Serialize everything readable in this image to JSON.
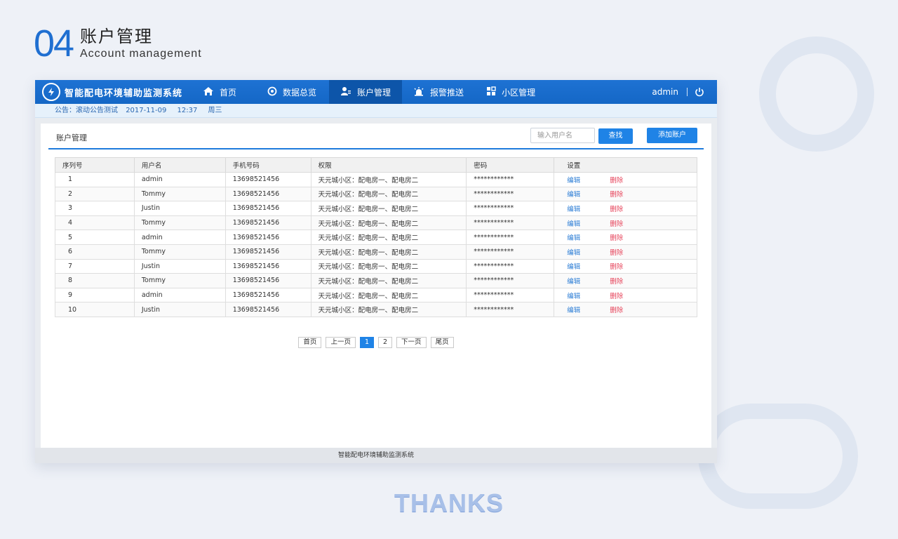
{
  "slide": {
    "number": "04",
    "title": "账户管理",
    "subtitle": "Account management",
    "thanks": "THANKS"
  },
  "app": {
    "brand": "智能配电环境辅助监测系统",
    "nav": [
      {
        "label": "首页",
        "icon": "home-icon"
      },
      {
        "label": "数据总览",
        "icon": "dashboard-icon"
      },
      {
        "label": "账户管理",
        "icon": "user-manage-icon",
        "active": true
      },
      {
        "label": "报警推送",
        "icon": "alarm-icon"
      },
      {
        "label": "小区管理",
        "icon": "grid-icon"
      }
    ],
    "user": "admin",
    "notice": {
      "label": "公告：滚动公告测试",
      "date": "2017-11-09",
      "time": "12:37",
      "weekday": "周三"
    },
    "footer": "智能配电环境辅助监测系统",
    "accent": "#1f83e6",
    "danger": "#e6435a"
  },
  "panel": {
    "title": "账户管理",
    "search_placeholder": "输入用户名",
    "search_button": "查找",
    "add_button": "添加账户"
  },
  "table": {
    "headers": [
      "序列号",
      "用户名",
      "手机号码",
      "权限",
      "密码",
      "设置"
    ],
    "edit_label": "编辑",
    "delete_label": "删除",
    "rows": [
      {
        "idx": "1",
        "user": "admin",
        "phone": "13698521456",
        "perm": "天元城小区：配电房一、配电房二",
        "pwd": "************"
      },
      {
        "idx": "2",
        "user": "Tommy",
        "phone": "13698521456",
        "perm": "天元城小区：配电房一、配电房二",
        "pwd": "************"
      },
      {
        "idx": "3",
        "user": "Justin",
        "phone": "13698521456",
        "perm": "天元城小区：配电房一、配电房二",
        "pwd": "************"
      },
      {
        "idx": "4",
        "user": "Tommy",
        "phone": "13698521456",
        "perm": "天元城小区：配电房一、配电房二",
        "pwd": "************"
      },
      {
        "idx": "5",
        "user": "admin",
        "phone": "13698521456",
        "perm": "天元城小区：配电房一、配电房二",
        "pwd": "************"
      },
      {
        "idx": "6",
        "user": "Tommy",
        "phone": "13698521456",
        "perm": "天元城小区：配电房一、配电房二",
        "pwd": "************"
      },
      {
        "idx": "7",
        "user": "Justin",
        "phone": "13698521456",
        "perm": "天元城小区：配电房一、配电房二",
        "pwd": "************"
      },
      {
        "idx": "8",
        "user": "Tommy",
        "phone": "13698521456",
        "perm": "天元城小区：配电房一、配电房二",
        "pwd": "************"
      },
      {
        "idx": "9",
        "user": "admin",
        "phone": "13698521456",
        "perm": "天元城小区：配电房一、配电房二",
        "pwd": "************"
      },
      {
        "idx": "10",
        "user": "Justin",
        "phone": "13698521456",
        "perm": "天元城小区：配电房一、配电房二",
        "pwd": "************"
      }
    ]
  },
  "pager": {
    "first": "首页",
    "prev": "上一页",
    "pages": [
      "1",
      "2"
    ],
    "current": "1",
    "next": "下一页",
    "last": "尾页"
  }
}
